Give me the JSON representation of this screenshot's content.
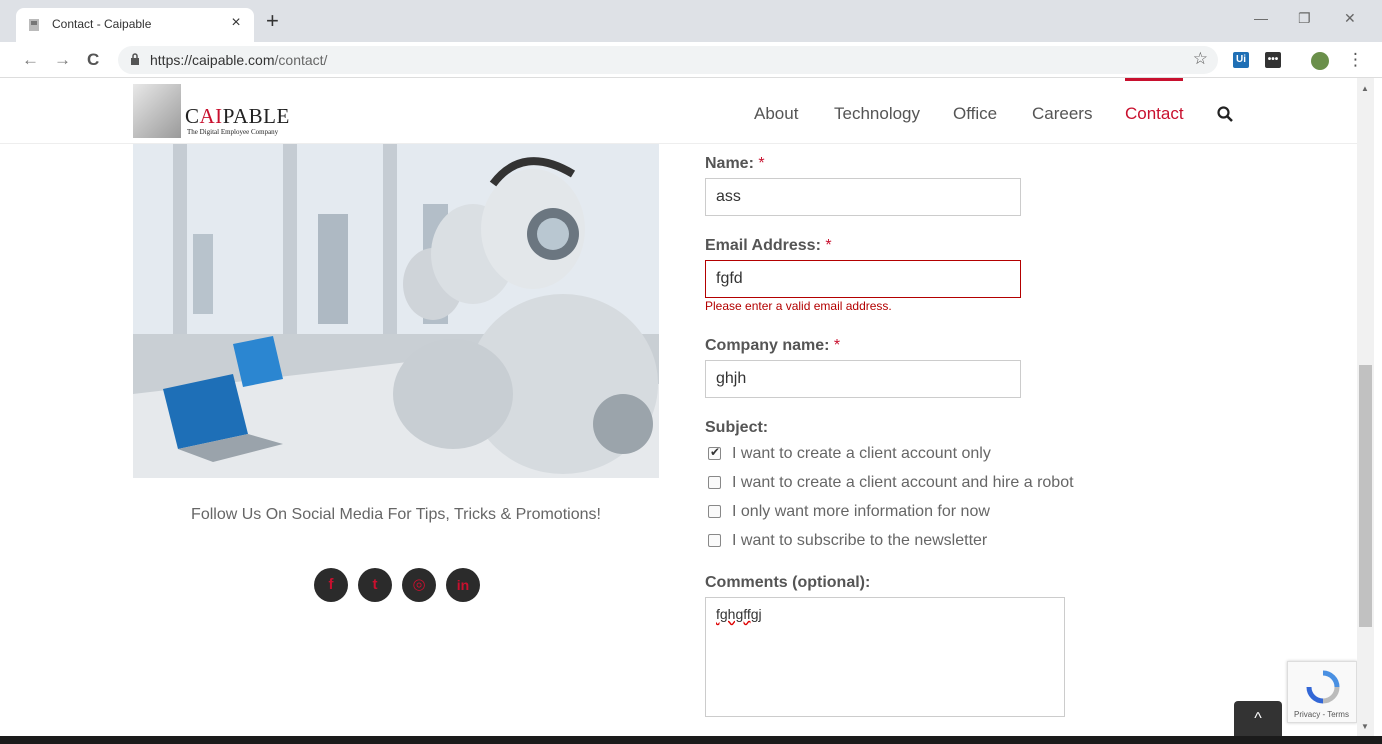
{
  "browser": {
    "tab_title": "Contact - Caipable",
    "tab_close": "×",
    "new_tab": "+",
    "url_host": "https://caipable.com",
    "url_path": "/contact/",
    "star": "☆",
    "ext_ui": "Ui",
    "ext_dots": "•••",
    "menu": "⋮",
    "minimize": "—",
    "restore": "❐",
    "close": "✕",
    "back": "←",
    "forward": "→",
    "reload": "C"
  },
  "header": {
    "logo_prefix": "C",
    "logo_ai": "AI",
    "logo_suffix": "PABLE",
    "logo_tagline": "The Digital Employee Company",
    "nav": [
      "About",
      "Technology",
      "Office",
      "Careers",
      "Contact"
    ],
    "active_nav": "Contact"
  },
  "left": {
    "follow_text": "Follow Us On Social Media For Tips, Tricks & Promotions!",
    "social": [
      {
        "name": "facebook",
        "glyph": "f"
      },
      {
        "name": "twitter",
        "glyph": "t"
      },
      {
        "name": "instagram",
        "glyph": "◎"
      },
      {
        "name": "linkedin",
        "glyph": "in"
      }
    ]
  },
  "form": {
    "required_mark": "*",
    "name_label": "Name:",
    "name_value": "ass",
    "email_label": "Email Address:",
    "email_value": "fgfd",
    "email_error": "Please enter a valid email address.",
    "company_label": "Company name:",
    "company_value": "ghjh",
    "subject_label": "Subject:",
    "subjects": [
      {
        "label": "I want to create a client account only",
        "checked": true
      },
      {
        "label": "I want to create a client account and hire a robot",
        "checked": false
      },
      {
        "label": "I only want more information for now",
        "checked": false
      },
      {
        "label": "I want to subscribe to the newsletter",
        "checked": false
      }
    ],
    "comments_label": "Comments (optional):",
    "comments_value": "fghgffgj"
  },
  "recaptcha": {
    "links": "Privacy - Terms"
  },
  "to_top": "^",
  "colors": {
    "accent": "#c8102e",
    "error": "#b30000"
  }
}
